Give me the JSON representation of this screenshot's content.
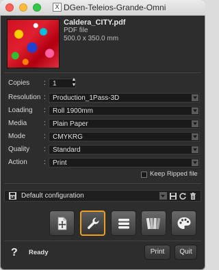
{
  "window": {
    "title": "DGen-Teleios-Grande-Omni",
    "app_icon_glyph": "X"
  },
  "file": {
    "name": "Caldera_CITY.pdf",
    "type": "PDF file",
    "size": "500.0 x 350.0 mm"
  },
  "settings": {
    "copies": {
      "label": "Copies",
      "value": "1"
    },
    "rows": [
      {
        "label": "Resolution",
        "value": "Production_1Pass-3D"
      },
      {
        "label": "Loading",
        "value": "Roll 1900mm"
      },
      {
        "label": "Media",
        "value": "Plain Paper"
      },
      {
        "label": "Mode",
        "value": "CMYKRG"
      },
      {
        "label": "Quality",
        "value": "Standard"
      },
      {
        "label": "Action",
        "value": "Print"
      }
    ],
    "colon": ":",
    "keep_ripped_label": "Keep Ripped file",
    "keep_ripped_checked": false
  },
  "config": {
    "label": "Default configuration"
  },
  "toolbar": {
    "tools": [
      {
        "icon": "layout-move-icon",
        "active": false
      },
      {
        "icon": "wrench-icon",
        "active": true
      },
      {
        "icon": "stack-lines-icon",
        "active": false
      },
      {
        "icon": "color-swatches-icon",
        "active": false
      },
      {
        "icon": "palette-icon",
        "active": false
      }
    ],
    "active_color": "#f0a020"
  },
  "footer": {
    "help_glyph": "?",
    "status": "Ready",
    "print_label": "Print",
    "quit_label": "Quit"
  }
}
